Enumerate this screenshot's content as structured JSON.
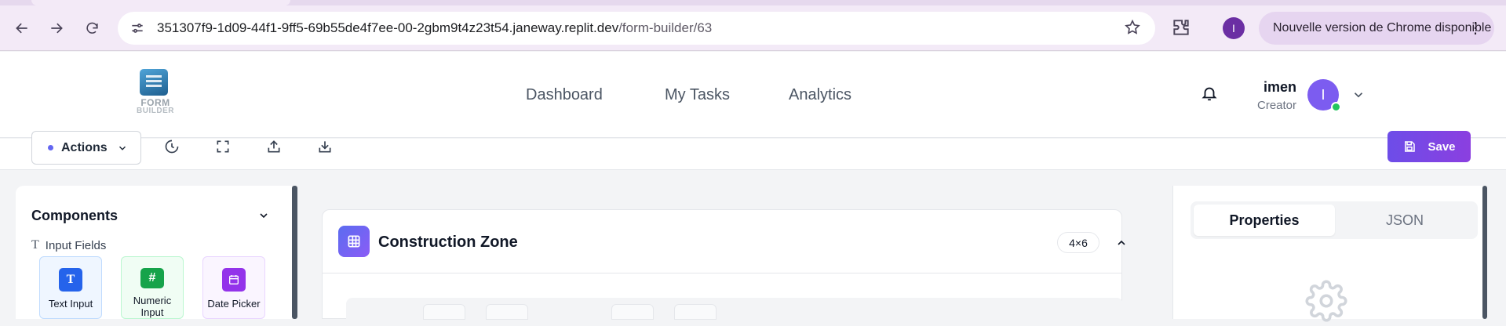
{
  "browser": {
    "url_host": "351307f9-1d09-44f1-9ff5-69b55de4f7ee-00-2gbm9t4z23t54.janeway.replit.dev",
    "url_path": "/form-builder/63",
    "profile_initial": "I",
    "update_label": "Nouvelle version de Chrome disponible"
  },
  "header": {
    "logo_line1": "FORM",
    "logo_line2": "BUILDER",
    "nav": [
      {
        "label": "Dashboard"
      },
      {
        "label": "My Tasks"
      },
      {
        "label": "Analytics"
      }
    ],
    "user": {
      "name": "imen",
      "role": "Creator",
      "initial": "I"
    }
  },
  "toolbar": {
    "actions_label": "Actions",
    "save_label": "Save"
  },
  "sidebar": {
    "title": "Components",
    "section_label": "Input Fields",
    "components": [
      {
        "label": "Text Input",
        "icon": "T",
        "color": "#2563eb"
      },
      {
        "label": "Numeric Input",
        "icon": "#",
        "color": "#16a34a"
      },
      {
        "label": "Date Picker",
        "icon": "calendar-icon",
        "color": "#9333ea"
      }
    ]
  },
  "zone": {
    "title": "Construction Zone",
    "size_badge": "4×6"
  },
  "panel": {
    "tabs": [
      {
        "label": "Properties",
        "active": true
      },
      {
        "label": "JSON",
        "active": false
      }
    ]
  }
}
